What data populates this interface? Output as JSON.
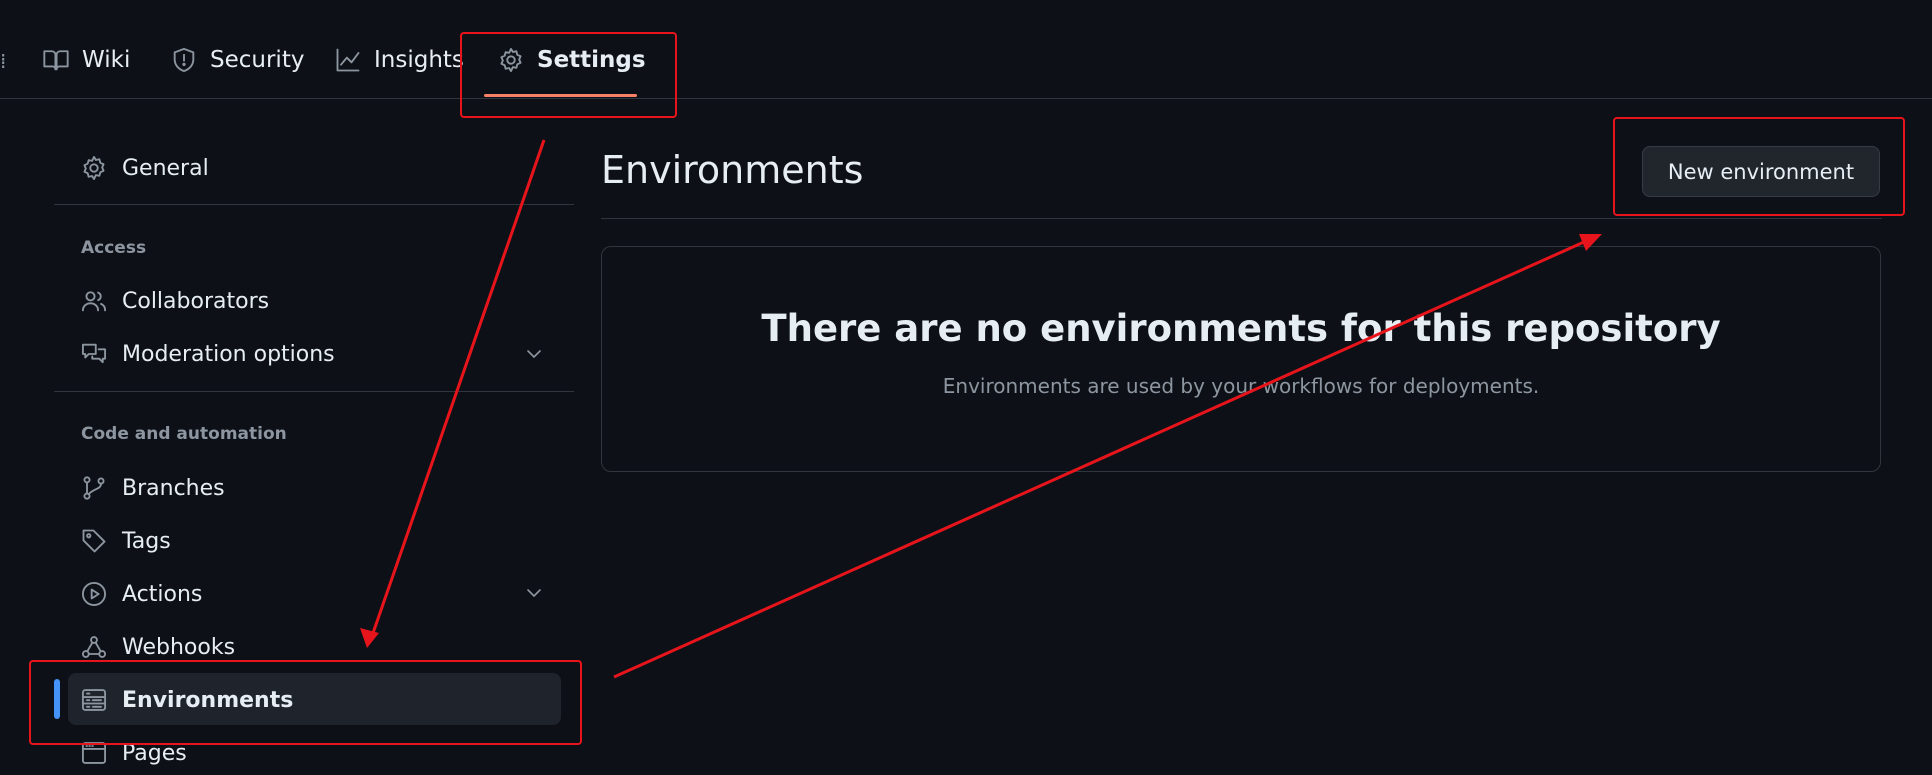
{
  "repo_nav": {
    "tabs": [
      {
        "label": "Wiki",
        "icon": "book-icon"
      },
      {
        "label": "Security",
        "icon": "shield-icon"
      },
      {
        "label": "Insights",
        "icon": "graph-icon"
      },
      {
        "label": "Settings",
        "icon": "gear-icon",
        "active": true
      }
    ]
  },
  "sidebar": {
    "general": {
      "label": "General",
      "icon": "gear-icon"
    },
    "access_heading": "Access",
    "access_items": [
      {
        "label": "Collaborators",
        "icon": "people-icon"
      },
      {
        "label": "Moderation options",
        "icon": "comment-discussion-icon",
        "expandable": true
      }
    ],
    "code_heading": "Code and automation",
    "code_items": [
      {
        "label": "Branches",
        "icon": "git-branch-icon"
      },
      {
        "label": "Tags",
        "icon": "tag-icon"
      },
      {
        "label": "Actions",
        "icon": "play-icon",
        "expandable": true
      },
      {
        "label": "Webhooks",
        "icon": "webhook-icon"
      },
      {
        "label": "Environments",
        "icon": "server-icon",
        "selected": true
      },
      {
        "label": "Pages",
        "icon": "browser-icon"
      }
    ]
  },
  "main": {
    "title": "Environments",
    "new_button_label": "New environment",
    "empty_title": "There are no environments for this repository",
    "empty_subtitle": "Environments are used by your workflows for deployments."
  },
  "colors": {
    "background": "#0d1117",
    "border": "#30363d",
    "text": "#e6edf3",
    "muted": "#8d96a0",
    "active_tab_underline": "#f78166",
    "selected_indicator": "#4493f8",
    "annotation": "#e8141b"
  }
}
